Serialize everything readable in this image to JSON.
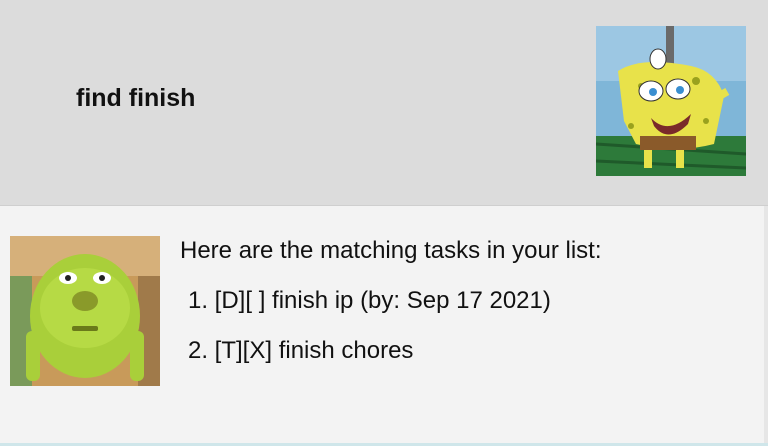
{
  "user_message": {
    "text": "find finish",
    "avatar_icon": "spongebob-mocking-avatar"
  },
  "bot_message": {
    "intro": "Here are the matching tasks in your list:",
    "tasks": [
      "1. [D][ ] finish ip (by: Sep 17 2021)",
      "2. [T][X] finish chores"
    ],
    "avatar_icon": "mike-wazowski-avatar"
  },
  "colors": {
    "user_bg": "#dcdcdc",
    "bot_bg": "#f3f3f3",
    "text": "#111111"
  }
}
